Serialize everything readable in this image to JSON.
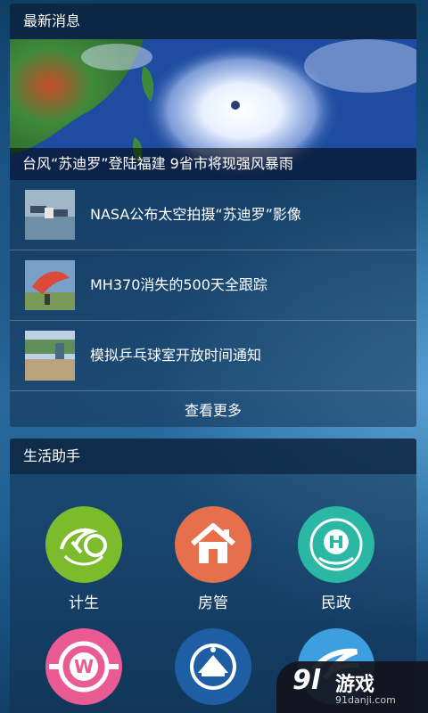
{
  "news": {
    "section_title": "最新消息",
    "headline": "台风“苏迪罗”登陆福建 9省市将现强风暴雨",
    "items": [
      {
        "title": "NASA公布太空拍摄“苏迪罗”影像",
        "thumb": "space-station-image"
      },
      {
        "title": "MH370消失的500天全跟踪",
        "thumb": "mh370-image"
      },
      {
        "title": "模拟乒乓球室开放时间通知",
        "thumb": "court-image"
      }
    ],
    "more_label": "查看更多"
  },
  "life": {
    "section_title": "生活助手",
    "apps": [
      {
        "label": "计生",
        "icon": "family-planning-icon",
        "color": "#7cbb2c"
      },
      {
        "label": "房管",
        "icon": "house-icon",
        "color": "#e5704b"
      },
      {
        "label": "民政",
        "icon": "civil-affairs-icon",
        "color": "#2ab7a3"
      },
      {
        "label": "",
        "icon": "w-logo-icon",
        "color": "#ea5a93"
      },
      {
        "label": "",
        "icon": "emblem-icon",
        "color": "#1e5ea5"
      },
      {
        "label": "",
        "icon": "wave-icon",
        "color": "#3e9fe0"
      }
    ]
  },
  "watermark": {
    "logo": "9l",
    "text": "游戏",
    "domain": "91danji.com"
  },
  "colors": {
    "header_bg": "#0e2a46",
    "card_bg": "#17406a"
  }
}
